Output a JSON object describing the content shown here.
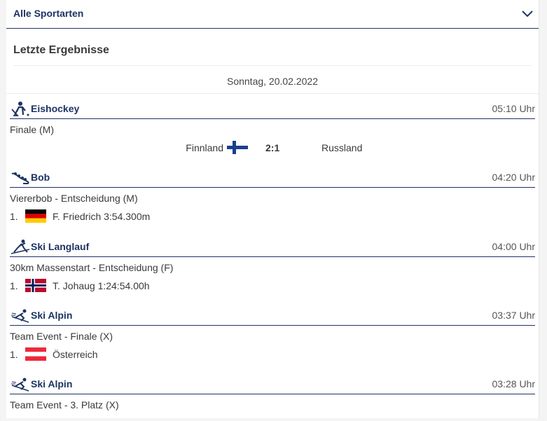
{
  "filter": {
    "label": "Alle Sportarten",
    "icon": "chevron-down-icon"
  },
  "section_title": "Letzte Ergebnisse",
  "date": "Sonntag, 20.02.2022",
  "colors": {
    "accent": "#1d3362",
    "text": "#3a3a3a"
  },
  "results": [
    {
      "sport": "Eishockey",
      "icon": "ice-hockey-icon",
      "time": "05:10 Uhr",
      "event": "Finale (M)",
      "match": {
        "home": "Finnland",
        "home_flag": "finland",
        "score": "2:1",
        "away": "Russland"
      }
    },
    {
      "sport": "Bob",
      "icon": "bobsleigh-icon",
      "time": "04:20 Uhr",
      "event": "Viererbob - Entscheidung (M)",
      "rank": "1.",
      "flag": "germany",
      "athlete": "F. Friedrich 3:54.300m"
    },
    {
      "sport": "Ski Langlauf",
      "icon": "cross-country-ski-icon",
      "time": "04:00 Uhr",
      "event": "30km Massenstart - Entscheidung (F)",
      "rank": "1.",
      "flag": "norway",
      "athlete": "T. Johaug 1:24:54.00h"
    },
    {
      "sport": "Ski Alpin",
      "icon": "alpine-ski-icon",
      "time": "03:37 Uhr",
      "event": "Team Event - Finale (X)",
      "rank": "1.",
      "flag": "austria",
      "athlete": "Österreich"
    },
    {
      "sport": "Ski Alpin",
      "icon": "alpine-ski-icon",
      "time": "03:28 Uhr",
      "event": "Team Event - 3. Platz (X)"
    }
  ]
}
